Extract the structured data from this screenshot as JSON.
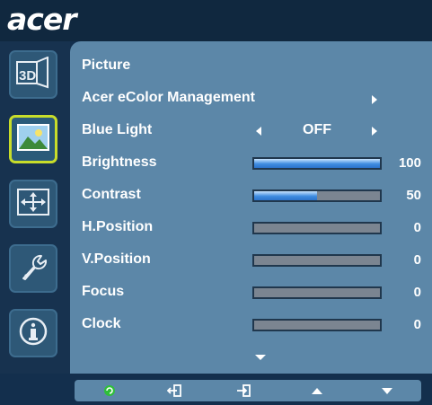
{
  "brand": {
    "logo_text": "acer"
  },
  "sidebar": {
    "items": [
      {
        "name": "3d",
        "icon": "3d-icon",
        "label": "3D",
        "selected": false
      },
      {
        "name": "picture",
        "icon": "picture-icon",
        "selected": true
      },
      {
        "name": "screen-position",
        "icon": "screen-position-icon",
        "selected": false
      },
      {
        "name": "settings",
        "icon": "wrench-icon",
        "selected": false
      },
      {
        "name": "information",
        "icon": "info-icon",
        "selected": false
      }
    ]
  },
  "panel": {
    "title": "Picture",
    "color_management": {
      "label": "Acer eColor Management"
    },
    "blue_light": {
      "label": "Blue Light",
      "value": "OFF"
    },
    "sliders": [
      {
        "label": "Brightness",
        "value": "100",
        "level": 1.0
      },
      {
        "label": "Contrast",
        "value": "50",
        "level": 0.5
      },
      {
        "label": "H.Position",
        "value": "0",
        "level": 0
      },
      {
        "label": "V.Position",
        "value": "0",
        "level": 0
      },
      {
        "label": "Focus",
        "value": "0",
        "level": 0
      },
      {
        "label": "Clock",
        "value": "0",
        "level": 0
      }
    ]
  },
  "bottom_bar": {
    "buttons": [
      "empowering-icon",
      "exit-icon",
      "enter-icon",
      "up-arrow-icon",
      "down-arrow-icon"
    ]
  },
  "colors": {
    "panel": "#5c87a8",
    "background": "#132f4d",
    "selected_border": "#c8dd2a",
    "slider_fill": "#3f8ce0",
    "slider_track": "#7b8591"
  }
}
